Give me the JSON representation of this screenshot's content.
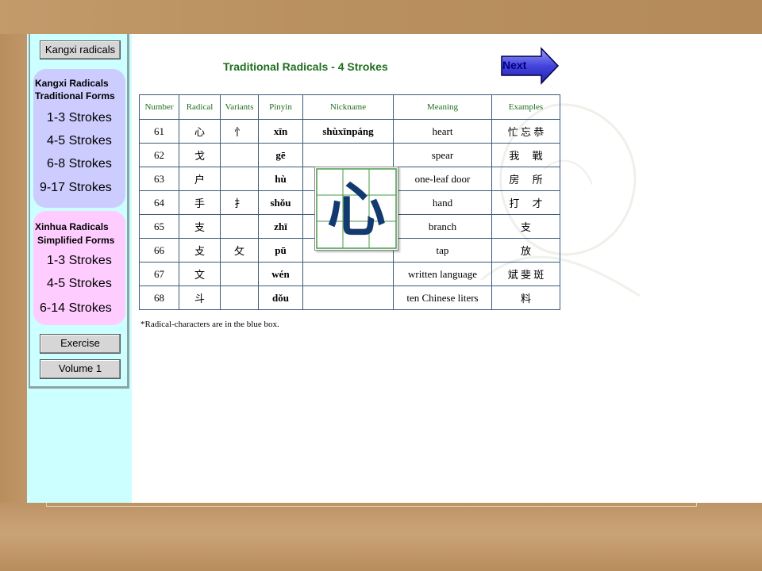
{
  "sidebar": {
    "top_button": "Kangxi radicals",
    "traditional": {
      "title_line1": "Kangxi Radicals",
      "title_line2": "Traditional Forms",
      "links": [
        "1-3 Strokes",
        "4-5 Strokes",
        "6-8 Strokes",
        "9-17 Strokes"
      ]
    },
    "simplified": {
      "title_line1": "Xinhua Radicals",
      "title_line2": "Simplified Forms",
      "links": [
        "1-3 Strokes",
        "4-5 Strokes",
        "6-14 Strokes"
      ]
    },
    "exercise_button": "Exercise",
    "volume_button": "Volume 1"
  },
  "main": {
    "title": "Traditional Radicals - 4 Strokes",
    "next_label": "Next",
    "footnote": "*Radical-characters are in the blue box.",
    "popup_char": "心",
    "table": {
      "headers": [
        "Number",
        "Radical",
        "Variants",
        "Pinyin",
        "Nickname",
        "Meaning",
        "Examples"
      ],
      "rows": [
        {
          "number": "61",
          "radical": "心",
          "variant": "忄",
          "pinyin": "xīn",
          "nickname": "shùxīnpáng",
          "meaning": "heart",
          "examples": "忙 忘 恭"
        },
        {
          "number": "62",
          "radical": "戈",
          "variant": "",
          "pinyin": "gē",
          "nickname": "",
          "meaning": "spear",
          "examples": "我　 戰"
        },
        {
          "number": "63",
          "radical": "户",
          "variant": "",
          "pinyin": "hù",
          "nickname": "",
          "meaning": "one-leaf door",
          "examples": "房　 所"
        },
        {
          "number": "64",
          "radical": "手",
          "variant": "扌",
          "pinyin": "shǒu",
          "nickname": "",
          "meaning": "hand",
          "examples": "打　 才"
        },
        {
          "number": "65",
          "radical": "支",
          "variant": "",
          "pinyin": "zhī",
          "nickname": "",
          "meaning": "branch",
          "examples": "支"
        },
        {
          "number": "66",
          "radical": "攴",
          "variant": "攵",
          "pinyin": "pū",
          "nickname": "",
          "meaning": "tap",
          "examples": "放"
        },
        {
          "number": "67",
          "radical": "文",
          "variant": "",
          "pinyin": "wén",
          "nickname": "",
          "meaning": "written language",
          "examples": "斌 斐 斑"
        },
        {
          "number": "68",
          "radical": "斗",
          "variant": "",
          "pinyin": "dǒu",
          "nickname": "",
          "meaning": "ten Chinese liters",
          "examples": "料"
        }
      ]
    }
  },
  "colors": {
    "sidebar_bg": "#ccffff",
    "traditional_pill": "#ccccff",
    "simplified_pill": "#ffccff",
    "title_green": "#1f6e1f",
    "radical_blue": "#1c3f8a",
    "next_arrow": "#3333cc"
  }
}
